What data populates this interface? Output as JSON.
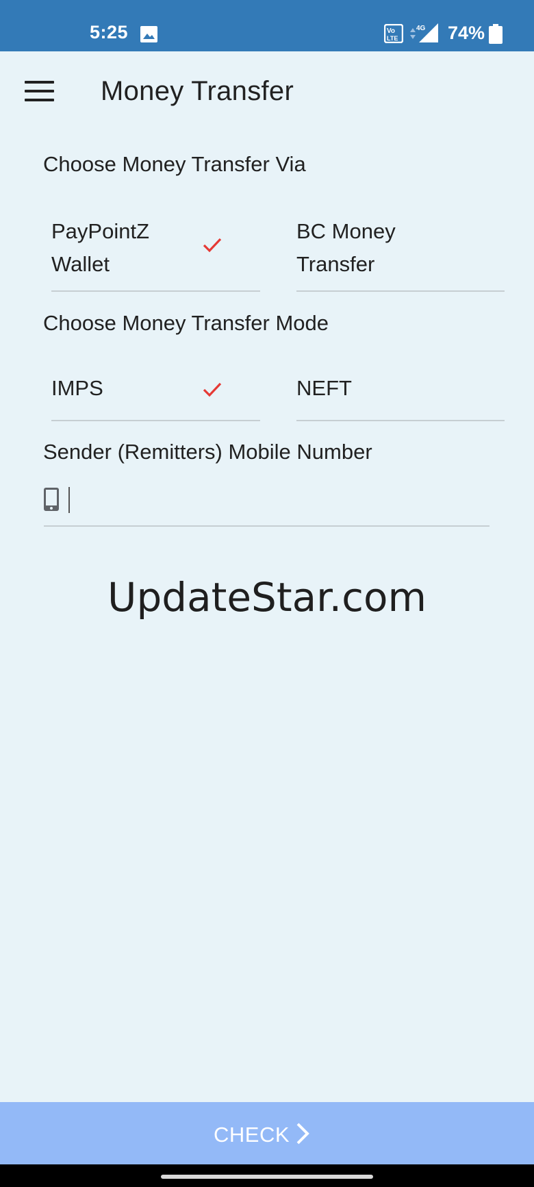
{
  "status_bar": {
    "time": "5:25",
    "battery_text": "74%",
    "network_type": "4G",
    "icons": [
      "gallery-icon",
      "volte-icon",
      "data-arrows-icon",
      "signal-icon",
      "battery-icon"
    ]
  },
  "app_bar": {
    "title": "Money Transfer",
    "menu_icon": "hamburger-menu-icon"
  },
  "transfer_via": {
    "label": "Choose Money Transfer Via",
    "options": [
      {
        "line1": "PayPointZ",
        "line2": "Wallet",
        "selected": true
      },
      {
        "line1": "BC Money",
        "line2": "Transfer",
        "selected": false
      }
    ]
  },
  "transfer_mode": {
    "label": "Choose Money Transfer Mode",
    "options": [
      {
        "label": "IMPS",
        "selected": true
      },
      {
        "label": "NEFT",
        "selected": false
      }
    ]
  },
  "sender": {
    "label": "Sender (Remitters) Mobile Number",
    "value": "",
    "placeholder": "",
    "icon": "phone-icon"
  },
  "watermark": "UpdateStar.com",
  "check_button": {
    "label": "CHECK",
    "icon": "chevron-right-icon"
  },
  "colors": {
    "status_bar": "#337ab7",
    "background": "#e8f3f8",
    "check_mark": "#e53935",
    "check_button": "#93b9f7",
    "divider": "#c6ced2"
  }
}
